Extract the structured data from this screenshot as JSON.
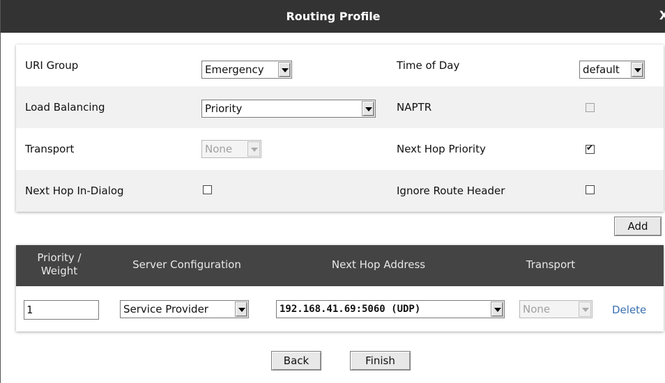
{
  "dialog": {
    "title": "Routing Profile",
    "close_label": "X"
  },
  "form": {
    "uri_group": {
      "label": "URI Group",
      "value": "Emergency"
    },
    "time_of_day": {
      "label": "Time of Day",
      "value": "default"
    },
    "load_balancing": {
      "label": "Load Balancing",
      "value": "Priority"
    },
    "naptr": {
      "label": "NAPTR",
      "checked": false,
      "disabled": true
    },
    "transport": {
      "label": "Transport",
      "value": "None",
      "disabled": true
    },
    "next_hop_priority": {
      "label": "Next Hop Priority",
      "checked": true
    },
    "next_hop_in_dialog": {
      "label": "Next Hop In-Dialog",
      "checked": false
    },
    "ignore_route_header": {
      "label": "Ignore Route Header",
      "checked": false
    }
  },
  "add_button_label": "Add",
  "table": {
    "headers": {
      "priority_weight_line1": "Priority /",
      "priority_weight_line2": "Weight",
      "server_configuration": "Server Configuration",
      "next_hop_address": "Next Hop Address",
      "transport": "Transport"
    },
    "rows": [
      {
        "priority": "1",
        "server_configuration": "Service Provider",
        "next_hop_address": "192.168.41.69:5060 (UDP)",
        "transport": "None",
        "delete_label": "Delete"
      }
    ]
  },
  "footer": {
    "back_label": "Back",
    "finish_label": "Finish"
  },
  "colors": {
    "title_bar": "#333333",
    "table_header": "#444444",
    "link": "#3a6fb0"
  }
}
